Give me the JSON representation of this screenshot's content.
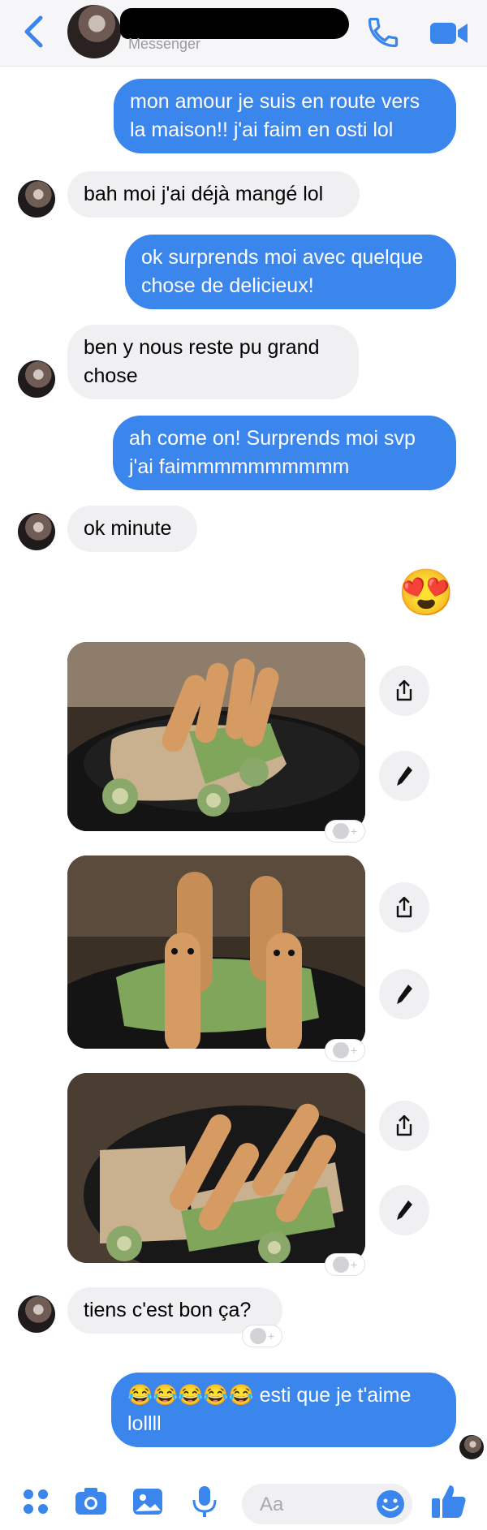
{
  "header": {
    "subtitle": "Messenger",
    "icons": [
      "back-chevron-icon",
      "phone-icon",
      "video-camera-icon"
    ],
    "accent": "#3a86ec"
  },
  "messages": [
    {
      "dir": "out",
      "text_lines": [
        "mon amour je suis en route vers",
        "la maison!! j'ai faim en osti lol"
      ]
    },
    {
      "dir": "in",
      "text_lines": [
        "bah moi j'ai déjà mangé lol"
      ]
    },
    {
      "dir": "out",
      "text_lines": [
        "ok surprends moi avec quelque",
        "chose de delicieux!"
      ]
    },
    {
      "dir": "in",
      "text_lines": [
        "ben y nous reste pu grand",
        "chose"
      ]
    },
    {
      "dir": "out",
      "text_lines": [
        "ah come on! Surprends moi svp",
        "j'ai faimmmmmmmmmm"
      ]
    },
    {
      "dir": "in",
      "text_lines": [
        "ok minute"
      ]
    },
    {
      "dir": "out",
      "emoji": "😍"
    },
    {
      "dir": "in",
      "photo": "hotdog-car-photo-1"
    },
    {
      "dir": "in",
      "photo": "hotdog-car-photo-2"
    },
    {
      "dir": "in",
      "photo": "hotdog-car-photo-3"
    },
    {
      "dir": "in",
      "text_lines": [
        "tiens c'est bon ça?"
      ]
    },
    {
      "dir": "out",
      "text_lines": [
        "😂😂😂😂😂 esti que je t'aime",
        "lollll"
      ]
    }
  ],
  "composer": {
    "placeholder": "Aa",
    "icons": [
      "apps-grid-icon",
      "camera-icon",
      "gallery-icon",
      "microphone-icon",
      "emoji-icon",
      "thumbs-up-icon"
    ]
  },
  "colors": {
    "outgoing_bubble": "#3a86ec",
    "incoming_bubble": "#f0f0f2"
  }
}
